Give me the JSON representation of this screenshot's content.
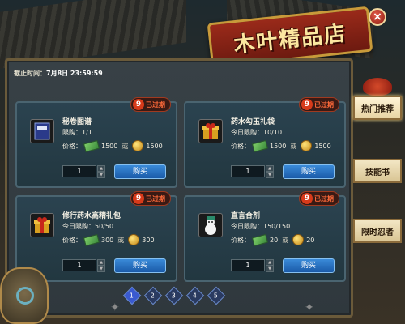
{
  "title": "木叶精品店",
  "deadline_label": "截止时间：",
  "deadline_time": "7月8日 23:59:59",
  "expired_label": "已过期",
  "price_label": "价格：",
  "or_label": "或",
  "buy_label": "购买",
  "close_symbol": "×",
  "stepper_up": "▲",
  "stepper_down": "▼",
  "items": [
    {
      "name": "秘卷图谱",
      "limit": "限购：1/1",
      "price_money": "1500",
      "price_coin": "1500",
      "qty": "1",
      "icon": "scroll-book-icon"
    },
    {
      "name": "药水勾玉礼袋",
      "limit": "今日限购：10/10",
      "price_money": "1500",
      "price_coin": "1500",
      "qty": "1",
      "icon": "gift-box-icon"
    },
    {
      "name": "修行药水高精礼包",
      "limit": "今日限购：50/50",
      "price_money": "300",
      "price_coin": "300",
      "qty": "1",
      "icon": "gift-box-icon"
    },
    {
      "name": "直言合剂",
      "limit": "今日限购：150/150",
      "price_money": "20",
      "price_coin": "20",
      "qty": "1",
      "icon": "snowman-icon"
    }
  ],
  "pages": [
    "1",
    "2",
    "3",
    "4",
    "5"
  ],
  "side_tabs": [
    "热门推荐",
    "技能书",
    "限时忍者"
  ],
  "colors": {
    "expired": "#ff6a3a",
    "buy_button": "#1a5aa8",
    "title_banner": "#9a2a1a"
  }
}
